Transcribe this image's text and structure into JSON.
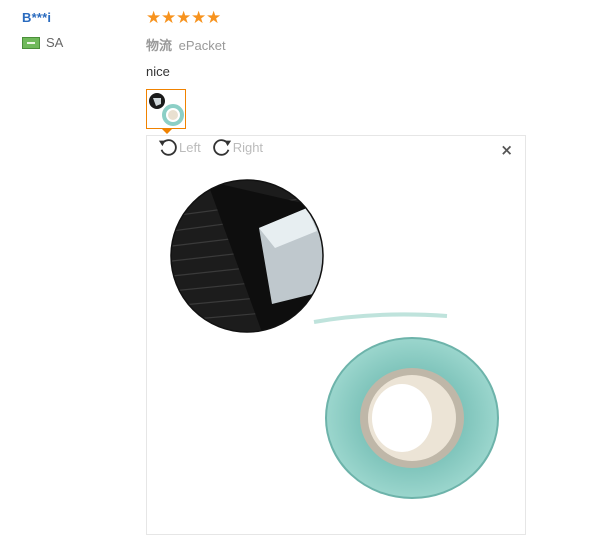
{
  "review": {
    "user_name": "B***i",
    "country_code": "SA",
    "rating": 5,
    "stars": [
      "★",
      "★",
      "★",
      "★",
      "★"
    ],
    "logistics_label": "物流",
    "logistics_value": "ePacket",
    "comment": "nice"
  },
  "viewer": {
    "rotate_left_label": "Left",
    "rotate_right_label": "Right",
    "close_symbol": "×"
  },
  "colors": {
    "star": "#f7931e",
    "user_name": "#2a6bbf",
    "thumb_border": "#f08200",
    "tape_teal": "#8ccfc6"
  }
}
